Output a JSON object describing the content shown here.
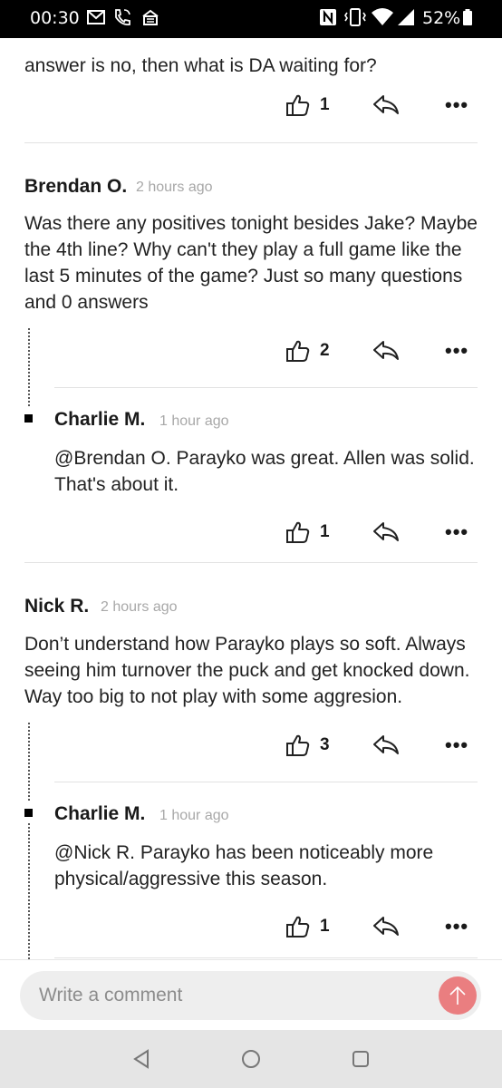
{
  "status_bar": {
    "time": "00:30",
    "battery": "52%",
    "icons": [
      "gmail-icon",
      "wifi-calling-icon",
      "news-icon",
      "nfc-icon",
      "vibrate-icon",
      "wifi-icon",
      "signal-icon",
      "battery-icon"
    ]
  },
  "previous_comment": {
    "text_tail": "answer is no, then what is DA waiting for?",
    "likes": "1"
  },
  "comments": [
    {
      "author": "Brendan O.",
      "time": "2 hours ago",
      "text": "Was there any positives tonight besides Jake? Maybe the 4th line? Why can't they play a full game like the last 5 minutes of the game? Just so many questions and 0 answers",
      "likes": "2",
      "reply": {
        "author": "Charlie M.",
        "time": "1 hour ago",
        "text": "@Brendan O. Parayko was great. Allen was solid. That's about it.",
        "likes": "1"
      }
    },
    {
      "author": "Nick R.",
      "time": "2 hours ago",
      "text": "Don’t understand how Parayko plays so soft. Always seeing him turnover the puck and get knocked down. Way too big to not play with some aggresion.",
      "likes": "3",
      "reply": {
        "author": "Charlie M.",
        "time": "1 hour ago",
        "text": "@Nick R. Parayko has been noticeably more physical/aggressive this season.",
        "likes": "1"
      }
    }
  ],
  "composer": {
    "placeholder": "Write a comment",
    "accent_color": "#ea7e80",
    "send_icon": "arrow-up-icon"
  },
  "nav_bar": {
    "icons": [
      "back-icon",
      "home-icon",
      "recents-icon"
    ]
  }
}
